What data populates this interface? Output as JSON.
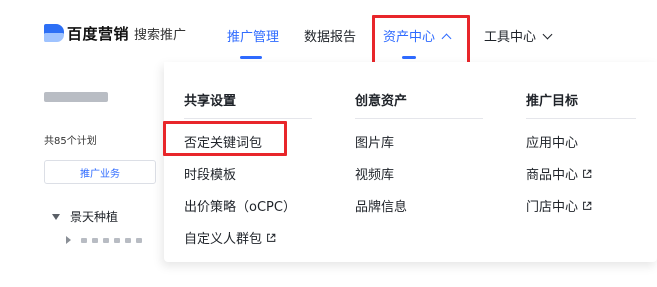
{
  "header": {
    "brand": "百度营销",
    "brand_sub": "搜索推广",
    "nav": [
      {
        "label": "推广管理"
      },
      {
        "label": "数据报告"
      },
      {
        "label": "资产中心"
      },
      {
        "label": "工具中心"
      }
    ]
  },
  "sidebar": {
    "plan_count": "共85个计划",
    "business_tab": "推广业务",
    "tree_parent": "景天种植"
  },
  "dropdown": {
    "columns": [
      {
        "heading": "共享设置",
        "items": [
          "否定关键词包",
          "时段模板",
          "出价策略（oCPC）",
          "自定义人群包"
        ]
      },
      {
        "heading": "创意资产",
        "items": [
          "图片库",
          "视频库",
          "品牌信息"
        ]
      },
      {
        "heading": "推广目标",
        "items": [
          "应用中心",
          "商品中心",
          "门店中心"
        ]
      }
    ]
  },
  "colors": {
    "accent": "#2f6bff",
    "highlight": "#e8262a",
    "text": "#1f2329"
  }
}
